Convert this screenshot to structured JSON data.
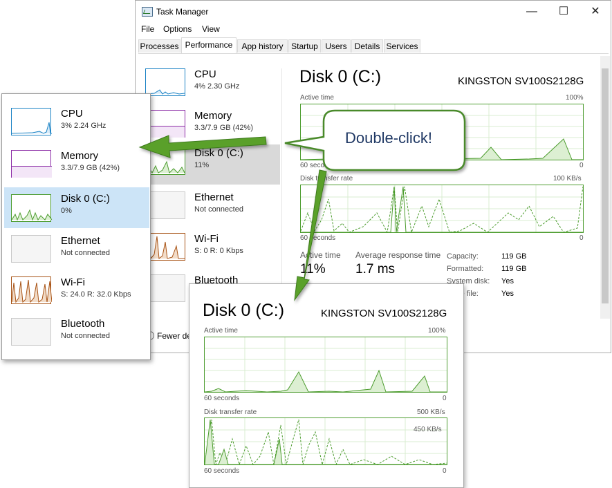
{
  "window": {
    "title": "Task Manager",
    "controls": {
      "minimize": "—",
      "maximize": "☐",
      "close": "✕"
    }
  },
  "menu": {
    "file": "File",
    "options": "Options",
    "view": "View"
  },
  "tabs": [
    "Processes",
    "Performance",
    "App history",
    "Startup",
    "Users",
    "Details",
    "Services"
  ],
  "active_tab": "Performance",
  "sidebar": {
    "items": [
      {
        "title": "CPU",
        "sub": "4%  2.30 GHz"
      },
      {
        "title": "Memory",
        "sub": "3.3/7.9 GB (42%)"
      },
      {
        "title": "Disk 0 (C:)",
        "sub": "11%"
      },
      {
        "title": "Ethernet",
        "sub": "Not connected"
      },
      {
        "title": "Wi-Fi",
        "sub": "S: 0  R: 0 Kbps"
      },
      {
        "title": "Bluetooth",
        "sub": ""
      }
    ],
    "fewer_details": "Fewer de"
  },
  "main": {
    "heading": "Disk 0 (C:)",
    "model": "KINGSTON SV100S2128G",
    "active_time_label": "Active time",
    "active_time_max": "100%",
    "seconds_label": "60 seconds",
    "zero": "0",
    "transfer_label": "Disk transfer rate",
    "transfer_max": "100 KB/s",
    "stats": {
      "active_time_label": "Active time",
      "active_time_value": "11%",
      "avg_response_label": "Average response time",
      "avg_response_value": "1.7 ms"
    },
    "props": [
      {
        "k": "Capacity:",
        "v": "119 GB"
      },
      {
        "k": "Formatted:",
        "v": "119 GB"
      },
      {
        "k": "System disk:",
        "v": "Yes"
      },
      {
        "k": "Page file:",
        "v": "Yes"
      }
    ]
  },
  "compact": {
    "items": [
      {
        "title": "CPU",
        "sub": "3%  2.24 GHz"
      },
      {
        "title": "Memory",
        "sub": "3.3/7.9 GB (42%)"
      },
      {
        "title": "Disk 0 (C:)",
        "sub": "0%"
      },
      {
        "title": "Ethernet",
        "sub": "Not connected"
      },
      {
        "title": "Wi-Fi",
        "sub": "S: 24.0  R: 32.0 Kbps"
      },
      {
        "title": "Bluetooth",
        "sub": "Not connected"
      }
    ]
  },
  "detail": {
    "heading": "Disk 0 (C:)",
    "model": "KINGSTON SV100S2128G",
    "active_time_label": "Active time",
    "active_time_max": "100%",
    "seconds_label": "60 seconds",
    "zero": "0",
    "transfer_label": "Disk transfer rate",
    "transfer_max": "500 KB/s",
    "transfer_mid": "450 KB/s"
  },
  "callout": {
    "text": "Double-click!"
  },
  "colors": {
    "disk_green": "#4c9c2e",
    "memory_purple": "#8b2ba5",
    "cpu_blue": "#1a82c4",
    "wifi_orange": "#a75214",
    "arrow_green": "#5aa02c",
    "callout_border": "#4a8a2a"
  }
}
